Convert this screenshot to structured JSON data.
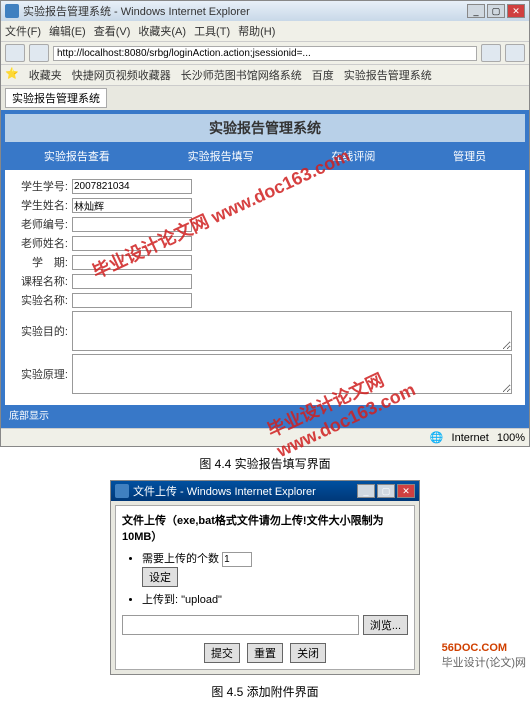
{
  "window1": {
    "title": "实验报告管理系统 - Windows Internet Explorer",
    "menu": [
      "文件(F)",
      "编辑(E)",
      "查看(V)",
      "收藏夹(A)",
      "工具(T)",
      "帮助(H)"
    ],
    "address": "http://localhost:8080/srbg/loginAction.action;jsessionid=...",
    "favbar": [
      "收藏夹",
      "快捷网页视频收藏器",
      "长沙师范图书馆网络系统",
      "百度",
      "实验报告管理系统"
    ],
    "tab": "实验报告管理系统",
    "app_title": "实验报告管理系统",
    "nav": [
      "实验报告查看",
      "实验报告填写",
      "在线评阅",
      "管理员"
    ],
    "form": {
      "student_id_label": "学生学号:",
      "student_id": "2007821034",
      "student_name_label": "学生姓名:",
      "student_name": "林灿辉",
      "teacher_id_label": "老师编号:",
      "teacher_id": "",
      "teacher_name_label": "老师姓名:",
      "teacher_name": "",
      "semester_label": "学　期:",
      "semester": "",
      "course_label": "课程名称:",
      "course": "",
      "exp_name_label": "实验名称:",
      "exp_name": "",
      "exp_purpose_label": "实验目的:",
      "exp_principle_label": "实验原理:"
    },
    "bottom_note": "底部显示",
    "status_internet": "Internet",
    "status_zoom": "100%"
  },
  "caption1": "图 4.4 实验报告填写界面",
  "window2": {
    "title": "文件上传 - Windows Internet Explorer",
    "head": "文件上传（exe,bat格式文件请勿上传!文件大小限制为10MB）",
    "count_label": "需要上传的个数",
    "count_value": "1",
    "set_btn": "设定",
    "dest_label": "上传到:",
    "dest_value": "\"upload\"",
    "browse_btn": "浏览...",
    "submit_btn": "提交",
    "reset_btn": "重置",
    "close_btn": "关闭"
  },
  "caption2": "图 4.5 添加附件界面",
  "watermark": "毕业设计论文网 www.doc163.com",
  "footer": "毕业设计(论文)网",
  "footer_url": "56DOC.COM"
}
